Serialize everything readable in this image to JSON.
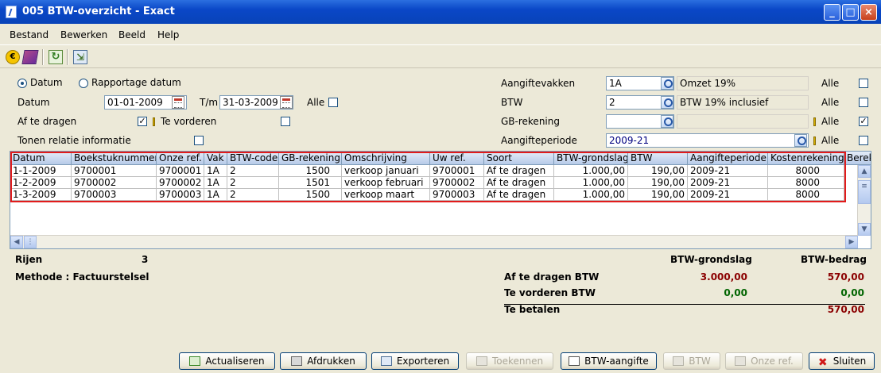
{
  "window": {
    "title": "005 BTW-overzicht - Exact"
  },
  "menu": {
    "items": [
      "Bestand",
      "Bewerken",
      "Beeld",
      "Help"
    ]
  },
  "toolbar": {
    "icons": [
      "euro-icon",
      "book-icon",
      "refresh-icon",
      "export-icon"
    ]
  },
  "filters": {
    "radio_datum": "Datum",
    "radio_rapportage": "Rapportage datum",
    "datum_label": "Datum",
    "datum_from": "01-01-2009",
    "tm_label": "T/m",
    "datum_to": "31-03-2009",
    "alle": "Alle",
    "af_te_dragen": "Af te dragen",
    "te_vorderen": "Te vorderen",
    "tonen_relatie": "Tonen relatie informatie",
    "aangiftevakken_label": "Aangiftevakken",
    "aangiftevakken_value": "1A",
    "aangiftevakken_desc": "Omzet 19%",
    "btw_label": "BTW",
    "btw_value": "2",
    "btw_desc": "BTW 19% inclusief",
    "gb_label": "GB-rekening",
    "gb_value": "",
    "periode_label": "Aangifteperiode",
    "periode_value": "2009-21"
  },
  "grid": {
    "columns": [
      "Datum",
      "Boekstuknummer",
      "Onze ref.",
      "Vak",
      "BTW-code",
      "GB-rekening",
      "Omschrijving",
      "Uw ref.",
      "Soort",
      "BTW-grondslag",
      "BTW",
      "Aangifteperiode",
      "Kostenrekening",
      "Berek"
    ],
    "rows": [
      [
        "1-1-2009",
        "9700001",
        "9700001",
        "1A",
        "2",
        "1500",
        "verkoop januari",
        "9700001",
        "Af te dragen",
        "1.000,00",
        "190,00",
        "2009-21",
        "8000"
      ],
      [
        "1-2-2009",
        "9700002",
        "9700002",
        "1A",
        "2",
        "1501",
        "verkoop februari",
        "9700002",
        "Af te dragen",
        "1.000,00",
        "190,00",
        "2009-21",
        "8000"
      ],
      [
        "1-3-2009",
        "9700003",
        "9700003",
        "1A",
        "2",
        "1500",
        "verkoop maart",
        "9700003",
        "Af te dragen",
        "1.000,00",
        "190,00",
        "2009-21",
        "8000"
      ]
    ]
  },
  "summary": {
    "rijen_label": "Rijen",
    "rijen_value": "3",
    "methode": "Methode : Factuurstelsel",
    "col_grondslag": "BTW-grondslag",
    "col_bedrag": "BTW-bedrag",
    "af_label": "Af te dragen BTW",
    "af_grondslag": "3.000,00",
    "af_bedrag": "570,00",
    "te_vorderen_label": "Te vorderen BTW",
    "tv_grondslag": "0,00",
    "tv_bedrag": "0,00",
    "te_betalen_label": "Te betalen",
    "te_betalen_bedrag": "570,00"
  },
  "buttons": {
    "actualiseren": "Actualiseren",
    "afdrukken": "Afdrukken",
    "exporteren": "Exporteren",
    "toekennen": "Toekennen",
    "btw_aangifte": "BTW-aangifte",
    "btw": "BTW",
    "onze_ref": "Onze ref.",
    "sluiten": "Sluiten"
  },
  "colors": {
    "negative": "#8b0000",
    "positive": "#006400",
    "highlight_box": "#e21b1b"
  }
}
